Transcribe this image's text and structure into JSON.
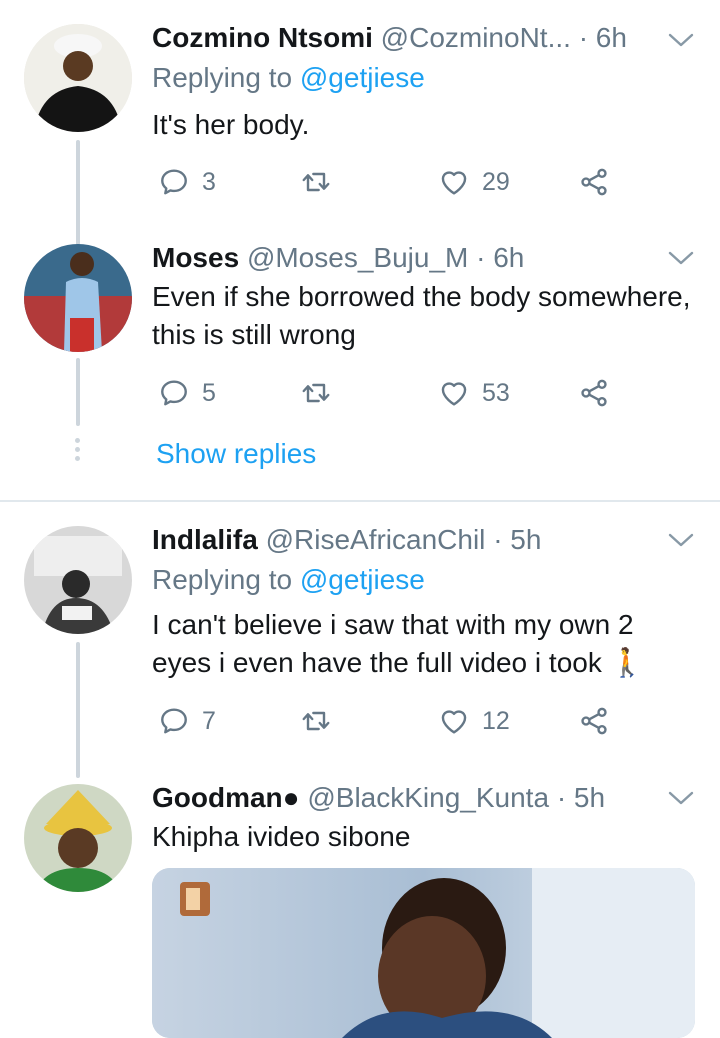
{
  "tweets": [
    {
      "name": "Cozmino Ntsomi",
      "handle": "@CozminoNt...",
      "time": "· 6h",
      "replying_label": "Replying to",
      "replying_handle": "@getjiese",
      "text": "It's her body.",
      "replies": "3",
      "likes": "29"
    },
    {
      "name": "Moses",
      "handle": "@Moses_Buju_M",
      "time": "· 6h",
      "text": "Even if she borrowed the body somewhere, this is still wrong",
      "replies": "5",
      "likes": "53"
    },
    {
      "name": "Indlalifa",
      "handle": "@RiseAfricanChil",
      "time": "· 5h",
      "replying_label": "Replying to",
      "replying_handle": "@getjiese",
      "text": "I can't believe i saw that with my own 2 eyes i even have the full video i took 🚶",
      "replies": "7",
      "likes": "12"
    },
    {
      "name": "Goodman●",
      "handle": "@BlackKing_Kunta",
      "time": "· 5h",
      "text": "Khipha ivideo sibone"
    }
  ],
  "show_replies": "Show replies",
  "colors": {
    "accent": "#1da1f2",
    "meta": "#657786",
    "thread": "#cdd5dc"
  },
  "icons": [
    "reply-icon",
    "retweet-icon",
    "like-icon",
    "share-icon",
    "chevron-down-icon"
  ]
}
